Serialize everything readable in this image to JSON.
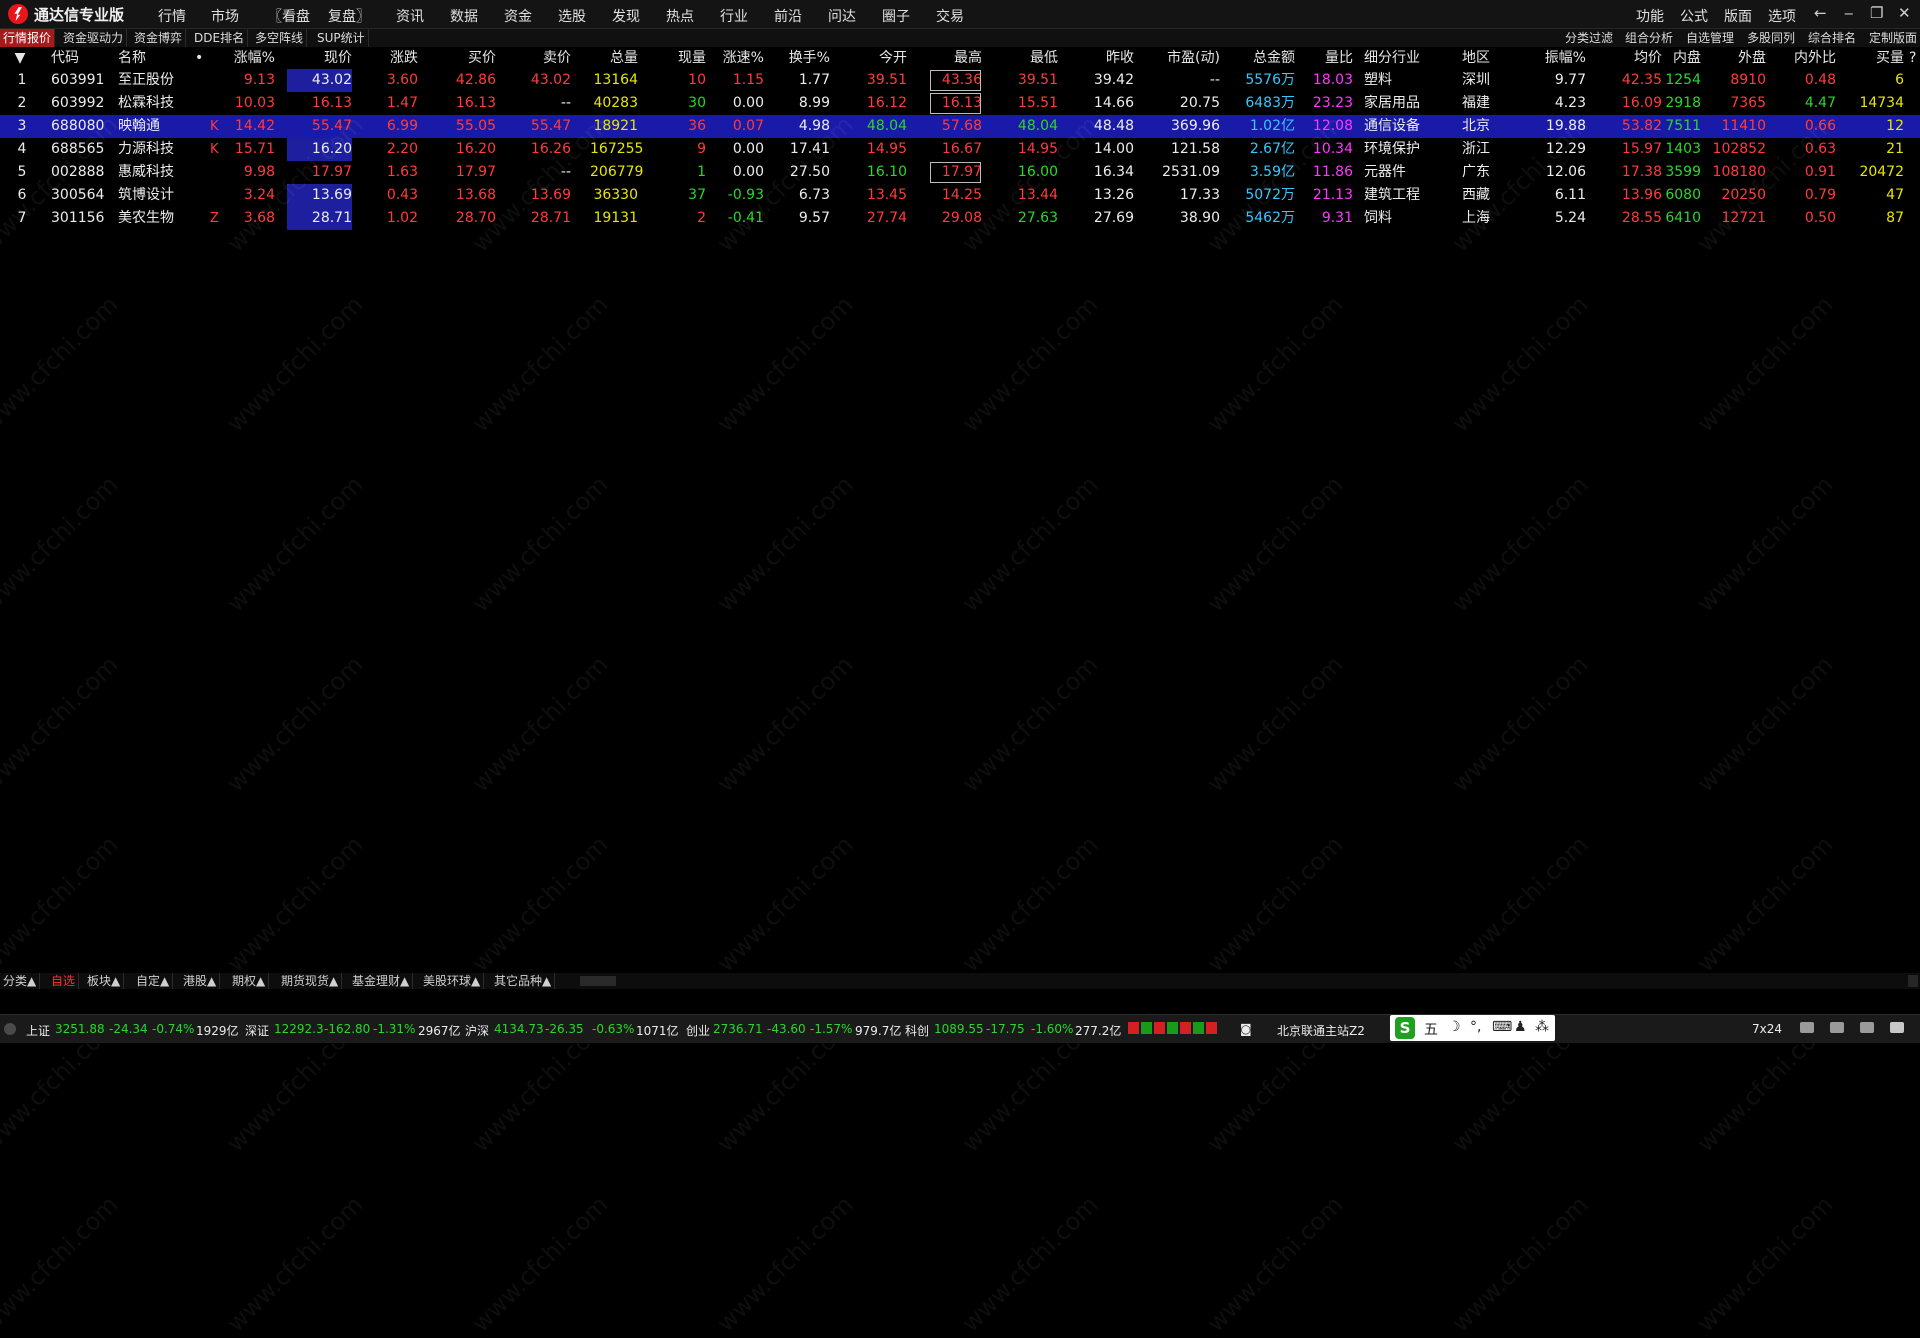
{
  "app": {
    "title": "通达信专业版"
  },
  "menu": [
    "行情",
    "市场",
    "〖看盘",
    "复盘〗",
    "资讯",
    "数据",
    "资金",
    "选股",
    "发现",
    "热点",
    "行业",
    "前沿",
    "问达",
    "圈子",
    "交易"
  ],
  "menu_right": [
    "功能",
    "公式",
    "版面",
    "选项"
  ],
  "toolbar_tabs": [
    "行情报价",
    "资金驱动力",
    "资金博弈",
    "DDE排名",
    "多空阵线",
    "SUP统计"
  ],
  "toolbar_right": [
    "分类过滤",
    "组合分析",
    "自选管理",
    "多股同列",
    "综合排名",
    "定制版面"
  ],
  "table": {
    "headers": {
      "idx": "▼",
      "code": "代码",
      "name": "名称",
      "dot": "•",
      "pct": "涨幅%",
      "price": "现价",
      "chg": "涨跌",
      "bid": "买价",
      "ask": "卖价",
      "vol": "总量",
      "cur": "现量",
      "speed": "涨速%",
      "turnover": "换手%",
      "open": "今开",
      "high": "最高",
      "low": "最低",
      "prev": "昨收",
      "pe": "市盈(动)",
      "amount": "总金额",
      "vr": "量比",
      "ind": "细分行业",
      "region": "地区",
      "amp": "振幅%",
      "avg": "均价",
      "inner": "内盘",
      "outer": "外盘",
      "ratio": "内外比",
      "buyvol": "买量",
      "q": "?"
    },
    "rows": [
      {
        "idx": "1",
        "code": "603991",
        "name": "至正股份",
        "flag": "",
        "pct": "9.13",
        "price": "43.02",
        "chg": "3.60",
        "bid": "42.86",
        "ask": "43.02",
        "vol": "13164",
        "cur": "10",
        "speed": "1.15",
        "turnover": "1.77",
        "open": "39.51",
        "high": "43.36",
        "low": "39.51",
        "prev": "39.42",
        "pe": "--",
        "amount": "5576万",
        "vr": "18.03",
        "ind": "塑料",
        "region": "深圳",
        "amp": "9.77",
        "avg": "42.35",
        "inner": "1254",
        "outer": "8910",
        "ratio": "0.48",
        "buyvol": "6"
      },
      {
        "idx": "2",
        "code": "603992",
        "name": "松霖科技",
        "flag": "",
        "pct": "10.03",
        "price": "16.13",
        "chg": "1.47",
        "bid": "16.13",
        "ask": "--",
        "vol": "40283",
        "cur": "30",
        "speed": "0.00",
        "turnover": "8.99",
        "open": "16.12",
        "high": "16.13",
        "low": "15.51",
        "prev": "14.66",
        "pe": "20.75",
        "amount": "6483万",
        "vr": "23.23",
        "ind": "家居用品",
        "region": "福建",
        "amp": "4.23",
        "avg": "16.09",
        "inner": "2918",
        "outer": "7365",
        "ratio": "4.47",
        "buyvol": "14734"
      },
      {
        "idx": "3",
        "code": "688080",
        "name": "映翰通",
        "flag": "K",
        "pct": "14.42",
        "price": "55.47",
        "chg": "6.99",
        "bid": "55.05",
        "ask": "55.47",
        "vol": "18921",
        "cur": "36",
        "speed": "0.07",
        "turnover": "4.98",
        "open": "48.04",
        "high": "57.68",
        "low": "48.04",
        "prev": "48.48",
        "pe": "369.96",
        "amount": "1.02亿",
        "vr": "12.08",
        "ind": "通信设备",
        "region": "北京",
        "amp": "19.88",
        "avg": "53.82",
        "inner": "7511",
        "outer": "11410",
        "ratio": "0.66",
        "buyvol": "12"
      },
      {
        "idx": "4",
        "code": "688565",
        "name": "力源科技",
        "flag": "K",
        "pct": "15.71",
        "price": "16.20",
        "chg": "2.20",
        "bid": "16.20",
        "ask": "16.26",
        "vol": "167255",
        "cur": "9",
        "speed": "0.00",
        "turnover": "17.41",
        "open": "14.95",
        "high": "16.67",
        "low": "14.95",
        "prev": "14.00",
        "pe": "121.58",
        "amount": "2.67亿",
        "vr": "10.34",
        "ind": "环境保护",
        "region": "浙江",
        "amp": "12.29",
        "avg": "15.97",
        "inner": "1403",
        "outer": "102852",
        "ratio": "0.63",
        "buyvol": "21"
      },
      {
        "idx": "5",
        "code": "002888",
        "name": "惠威科技",
        "flag": "",
        "pct": "9.98",
        "price": "17.97",
        "chg": "1.63",
        "bid": "17.97",
        "ask": "--",
        "vol": "206779",
        "cur": "1",
        "speed": "0.00",
        "turnover": "27.50",
        "open": "16.10",
        "high": "17.97",
        "low": "16.00",
        "prev": "16.34",
        "pe": "2531.09",
        "amount": "3.59亿",
        "vr": "11.86",
        "ind": "元器件",
        "region": "广东",
        "amp": "12.06",
        "avg": "17.38",
        "inner": "3599",
        "outer": "108180",
        "ratio": "0.91",
        "buyvol": "20472"
      },
      {
        "idx": "6",
        "code": "300564",
        "name": "筑博设计",
        "flag": "",
        "pct": "3.24",
        "price": "13.69",
        "chg": "0.43",
        "bid": "13.68",
        "ask": "13.69",
        "vol": "36330",
        "cur": "37",
        "speed": "-0.93",
        "turnover": "6.73",
        "open": "13.45",
        "high": "14.25",
        "low": "13.44",
        "prev": "13.26",
        "pe": "17.33",
        "amount": "5072万",
        "vr": "21.13",
        "ind": "建筑工程",
        "region": "西藏",
        "amp": "6.11",
        "avg": "13.96",
        "inner": "6080",
        "outer": "20250",
        "ratio": "0.79",
        "buyvol": "47"
      },
      {
        "idx": "7",
        "code": "301156",
        "name": "美农生物",
        "flag": "Z",
        "pct": "3.68",
        "price": "28.71",
        "chg": "1.02",
        "bid": "28.70",
        "ask": "28.71",
        "vol": "19131",
        "cur": "2",
        "speed": "-0.41",
        "turnover": "9.57",
        "open": "27.74",
        "high": "29.08",
        "low": "27.63",
        "prev": "27.69",
        "pe": "38.90",
        "amount": "5462万",
        "vr": "9.31",
        "ind": "饲料",
        "region": "上海",
        "amp": "5.24",
        "avg": "28.55",
        "inner": "6410",
        "outer": "12721",
        "ratio": "0.50",
        "buyvol": "87"
      }
    ]
  },
  "bottom_tabs": [
    "分类▲",
    "自选",
    "板块▲",
    "自定▲",
    "港股▲",
    "期权▲",
    "期货现货▲",
    "基金理财▲",
    "美股环球▲",
    "其它品种▲"
  ],
  "status": {
    "sh_label": "上证",
    "sh_val": "3251.88",
    "sh_chg": "-24.34",
    "sh_pct": "-0.74%",
    "sh_amt": "1929亿",
    "sz_label": "深证",
    "sz_val": "12292.3",
    "sz_chg": "-162.80",
    "sz_pct": "-1.31%",
    "sz_amt": "2967亿",
    "hs_label": "沪深",
    "hs_val": "4134.73",
    "hs_chg": "-26.35",
    "hs_pct": "-0.63%",
    "hs_amt": "1071亿",
    "cy_label": "创业",
    "cy_val": "2736.71",
    "cy_chg": "-43.60",
    "cy_pct": "-1.57%",
    "cy_amt": "979.7亿",
    "kc_label": "科创",
    "kc_val": "1089.55",
    "kc_chg": "-17.75",
    "kc_pct": "-1.60%",
    "kc_amt": "277.2亿",
    "server": "北京联通主站Z2",
    "ime_items": [
      "五",
      "☽",
      "°,",
      "⌨",
      "♟",
      "⁂"
    ],
    "hours": "7x24"
  },
  "watermark": "www.cfchi.com",
  "colors": {
    "up": "#ff3b3b",
    "down": "#2bd62b",
    "selected_row": "#1a1aa8",
    "price_box": "#1d1f9e",
    "active_tab": "#a51a1a"
  }
}
